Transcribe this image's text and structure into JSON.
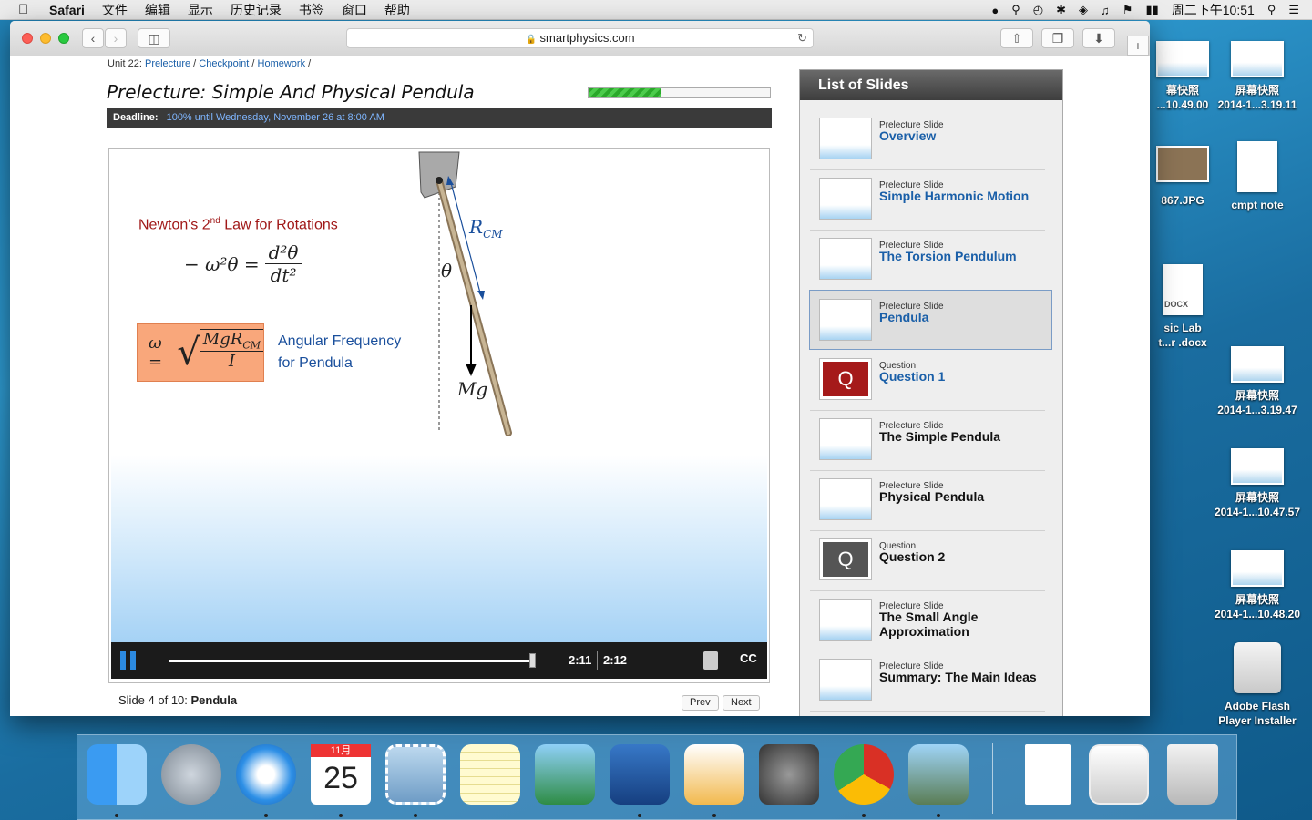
{
  "menubar": {
    "app": "Safari",
    "items": [
      "文件",
      "编辑",
      "显示",
      "历史记录",
      "书签",
      "窗口",
      "帮助"
    ],
    "clock": "周二下午10:51"
  },
  "desktop": {
    "icons": [
      {
        "line1": "幕快照",
        "line2": "...10.49.00"
      },
      {
        "line1": "屏幕快照",
        "line2": "2014-1...3.19.11"
      },
      {
        "line1": "867.JPG",
        "line2": ""
      },
      {
        "line1": "cmpt note",
        "line2": ""
      },
      {
        "line1": "sic Lab",
        "line2": "t...r .docx"
      },
      {
        "line1": "屏幕快照",
        "line2": "2014-1...3.19.47"
      },
      {
        "line1": "屏幕快照",
        "line2": "2014-1...10.47.57"
      },
      {
        "line1": "屏幕快照",
        "line2": "2014-1...10.48.20"
      },
      {
        "line1": "Adobe Flash",
        "line2": "Player Installer"
      }
    ],
    "docx_badge": "DOCX"
  },
  "browser": {
    "url": "smartphysics.com"
  },
  "page": {
    "unit_prefix": "Unit 22:",
    "breadcrumbs": [
      "Prelecture",
      "Checkpoint",
      "Homework"
    ],
    "title": "Prelecture: Simple And Physical Pendula",
    "progress_fraction": 0.4,
    "deadline_label": "Deadline:",
    "deadline_value": "100% until Wednesday, November 26 at 8:00 AM"
  },
  "slide": {
    "law_title_pre": "Newton's 2",
    "law_title_sup": "nd",
    "law_title_post": " Law for Rotations",
    "eq_lhs": "− ω²θ =",
    "eq_num": "d²θ",
    "eq_den": "dt²",
    "omega_lhs": "ω =",
    "omega_num": "MgR",
    "omega_num_sub": "CM",
    "omega_den": "I",
    "angfreq_line1": "Angular Frequency",
    "angfreq_line2": "for Pendula",
    "rcm_main": "R",
    "rcm_sub": "CM",
    "theta": "θ",
    "mg": "Mg"
  },
  "player": {
    "current_time": "2:11",
    "total_time": "2:12",
    "played_fraction": 0.99,
    "cc_label": "CC"
  },
  "slide_footer": {
    "counter": "Slide 4 of 10:",
    "name": "Pendula",
    "prev": "Prev",
    "next": "Next"
  },
  "sidebar": {
    "header": "List of Slides",
    "items": [
      {
        "kind": "Prelecture Slide",
        "title": "Overview",
        "thumb": "slide",
        "active": false,
        "blue": true
      },
      {
        "kind": "Prelecture Slide",
        "title": "Simple Harmonic Motion",
        "thumb": "slide",
        "active": false,
        "blue": true
      },
      {
        "kind": "Prelecture Slide",
        "title": "The Torsion Pendulum",
        "thumb": "slide",
        "active": false,
        "blue": true
      },
      {
        "kind": "Prelecture Slide",
        "title": "Pendula",
        "thumb": "slide",
        "active": true,
        "blue": true
      },
      {
        "kind": "Question",
        "title": "Question 1",
        "thumb": "q-red",
        "active": false,
        "blue": true
      },
      {
        "kind": "Prelecture Slide",
        "title": "The Simple Pendula",
        "thumb": "slide",
        "active": false,
        "blue": false
      },
      {
        "kind": "Prelecture Slide",
        "title": "Physical Pendula",
        "thumb": "slide",
        "active": false,
        "blue": false
      },
      {
        "kind": "Question",
        "title": "Question 2",
        "thumb": "q-grey",
        "active": false,
        "blue": false
      },
      {
        "kind": "Prelecture Slide",
        "title": "The Small Angle Approximation",
        "thumb": "slide",
        "active": false,
        "blue": false
      },
      {
        "kind": "Prelecture Slide",
        "title": "Summary: The Main Ideas",
        "thumb": "slide",
        "active": false,
        "blue": false
      }
    ]
  },
  "dock": {
    "apps": [
      "finder-icon",
      "launchpad-icon",
      "safari-icon",
      "calendar-icon",
      "mail-icon",
      "notes-icon",
      "iphoto-icon",
      "dictionary-icon",
      "pages-icon",
      "system-preferences-icon",
      "chrome-icon",
      "preview-icon",
      "document-icon",
      "screenshot-chrome-icon",
      "trash-icon"
    ],
    "calendar_month": "11月",
    "calendar_day": "25"
  },
  "colors": {
    "accent_blue": "#1a5fa8",
    "law_red": "#a01818",
    "omega_box": "#f9a77b",
    "active_border": "#7a9cc6"
  }
}
